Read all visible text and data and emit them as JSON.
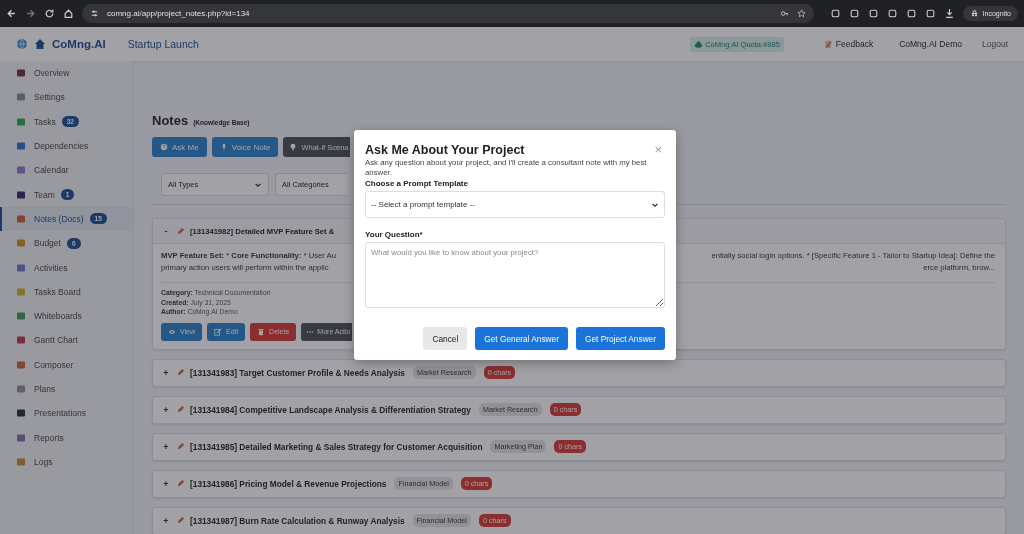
{
  "browser": {
    "url": "comng.ai/app/project_notes.php?id=134",
    "profile": "Incognito"
  },
  "header": {
    "brand": "CoMng.AI",
    "project": "Startup Launch",
    "quota": "CoMng.AI Quota:4985",
    "feedback": "Feedback",
    "user": "CoMng.AI Demo",
    "logout": "Logout"
  },
  "sidebar": {
    "items": [
      {
        "label": "Overview",
        "selected": false
      },
      {
        "label": "Settings",
        "selected": false
      },
      {
        "label": "Tasks",
        "badge": "32",
        "selected": false
      },
      {
        "label": "Dependencies",
        "selected": false
      },
      {
        "label": "Calendar",
        "selected": false
      },
      {
        "label": "Team",
        "badge": "1",
        "selected": false
      },
      {
        "label": "Notes (Docs)",
        "badge": "15",
        "selected": true
      },
      {
        "label": "Budget",
        "badge": "0",
        "selected": false
      },
      {
        "label": "Activities",
        "selected": false
      },
      {
        "label": "Tasks Board",
        "selected": false
      },
      {
        "label": "Whiteboards",
        "selected": false
      },
      {
        "label": "Gantt Chart",
        "selected": false
      },
      {
        "label": "Composer",
        "selected": false
      },
      {
        "label": "Plans",
        "selected": false
      },
      {
        "label": "Presentations",
        "selected": false
      },
      {
        "label": "Reports",
        "selected": false
      },
      {
        "label": "Logs",
        "selected": false
      }
    ]
  },
  "page": {
    "title": "Notes",
    "subtitle": "(Knowledge Base)",
    "actions": [
      {
        "label": "Ask Me",
        "kind": "primary"
      },
      {
        "label": "Voice Note",
        "kind": "primary"
      },
      {
        "label": "What-if Scena",
        "kind": "dark"
      }
    ],
    "filters": [
      "All Types",
      "All Categories"
    ],
    "notes": [
      {
        "toggle": "-",
        "expanded": true,
        "title": "[131341982] Detailed MVP Feature Set &",
        "summary": [
          {
            "left": "**MVP Feature Set:** * **Core Functionality:** * User Au",
            "right": "entially social login options. * [Specific Feature 1 - Tailor to Startup Idea]: Define the"
          },
          {
            "left": "primary action users will perform within the applic",
            "right": "erce platform, brow..."
          }
        ],
        "meta": [
          {
            "label": "Category:",
            "value": "Technical Documentation"
          },
          {
            "label": "Created:",
            "value": "July 31, 2025"
          },
          {
            "label": "Author:",
            "value": "CoMng.AI Demo"
          }
        ],
        "buttons": [
          {
            "label": "View",
            "kind": "primary"
          },
          {
            "label": "Edit",
            "kind": "primary"
          },
          {
            "label": "Delete",
            "kind": "danger"
          },
          {
            "label": "More Actio",
            "kind": "dark"
          }
        ]
      },
      {
        "toggle": "+",
        "expanded": false,
        "title": "[131341983] Target Customer Profile & Needs Analysis",
        "tag": "Market Research",
        "chars": "0 chars"
      },
      {
        "toggle": "+",
        "expanded": false,
        "title": "[131341984] Competitive Landscape Analysis & Differentiation Strategy",
        "tag": "Market Research",
        "chars": "0 chars"
      },
      {
        "toggle": "+",
        "expanded": false,
        "title": "[131341985] Detailed Marketing & Sales Strategy for Customer Acquisition",
        "tag": "Marketing Plan",
        "chars": "0 chars"
      },
      {
        "toggle": "+",
        "expanded": false,
        "title": "[131341986] Pricing Model & Revenue Projections",
        "tag": "Financial Model",
        "chars": "0 chars"
      },
      {
        "toggle": "+",
        "expanded": false,
        "title": "[131341987] Burn Rate Calculation & Runway Analysis",
        "tag": "Financial Model",
        "chars": "0 chars"
      }
    ]
  },
  "modal": {
    "title": "Ask Me About Your Project",
    "close": "×",
    "description": "Ask any question about your project, and I'll create a consultant note with my best answer.",
    "template_label": "Choose a Prompt Template",
    "template_select": "-- Select a prompt template --",
    "question_label": "Your Question*",
    "question_placeholder": "What would you like to know about your project?",
    "buttons": [
      {
        "label": "Cancel",
        "kind": "secondary"
      },
      {
        "label": "Get General Answer",
        "kind": "primary"
      },
      {
        "label": "Get Project Answer",
        "kind": "primary"
      }
    ]
  }
}
